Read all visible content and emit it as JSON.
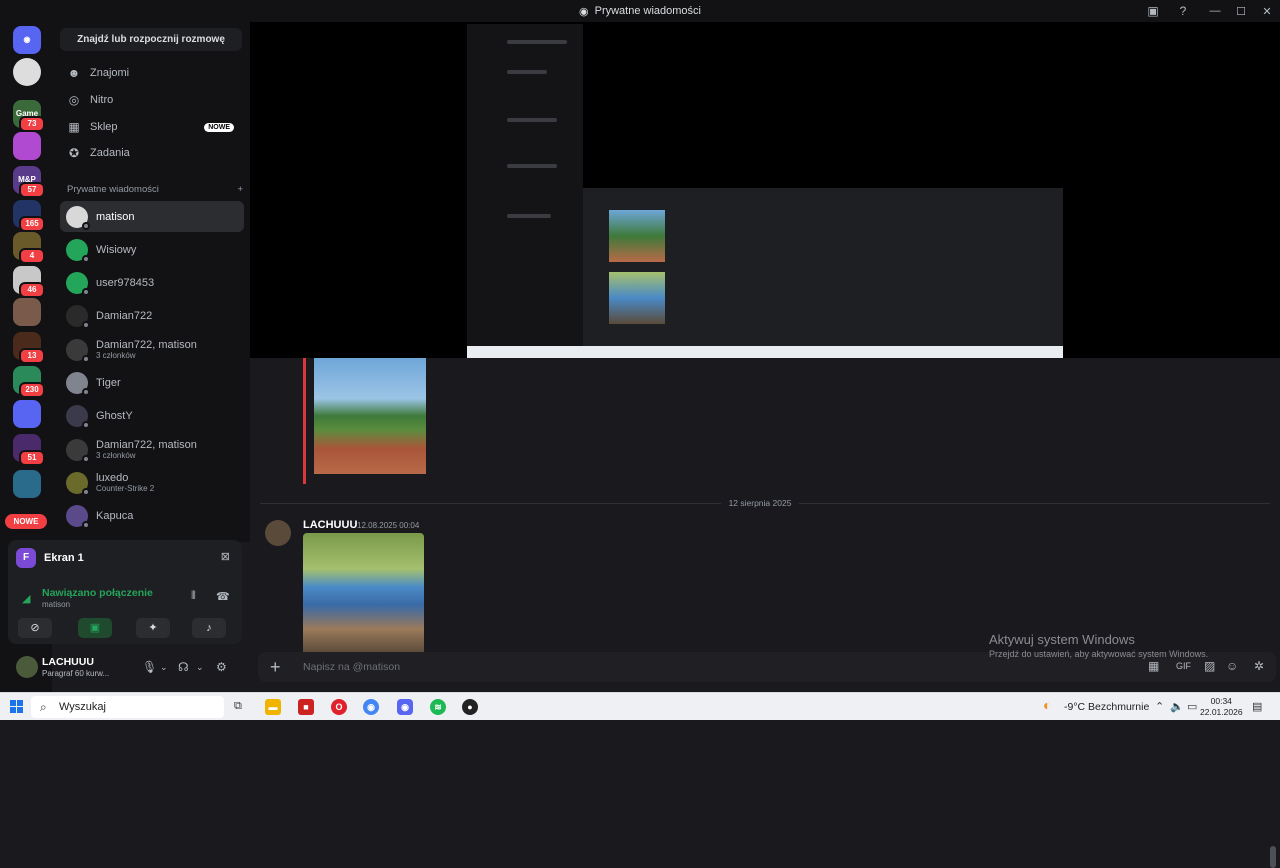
{
  "window": {
    "title": "Prywatne wiadomości"
  },
  "servers": [
    {
      "name": "Game",
      "badge": "73",
      "color": "#3a6a3a"
    },
    {
      "name": "",
      "badge": "",
      "color": "#b04ad0"
    },
    {
      "name": "M&P",
      "badge": "57",
      "color": "#5a3a8a"
    },
    {
      "name": "",
      "badge": "165",
      "color": "#223366"
    },
    {
      "name": "",
      "badge": "4",
      "color": "#6a5a2a"
    },
    {
      "name": "",
      "badge": "46",
      "color": "#c8c8c8"
    },
    {
      "name": "",
      "badge": "",
      "color": "#7a5a4a"
    },
    {
      "name": "",
      "badge": "13",
      "color": "#4a2a1a"
    },
    {
      "name": "",
      "badge": "230",
      "color": "#2a8a5a"
    },
    {
      "name": "",
      "badge": "",
      "color": "#5865f2"
    },
    {
      "name": "",
      "badge": "51",
      "color": "#4a2a6a"
    },
    {
      "name": "",
      "badge": "",
      "color": "#2a6a8a"
    }
  ],
  "new_label": "NOWE",
  "sidebar": {
    "search": "Znajdź lub rozpocznij rozmowę",
    "nav": [
      {
        "label": "Znajomi",
        "icon": "friends-icon"
      },
      {
        "label": "Nitro",
        "icon": "nitro-icon"
      },
      {
        "label": "Sklep",
        "icon": "shop-icon",
        "badge": "NOWE"
      },
      {
        "label": "Zadania",
        "icon": "quests-icon"
      }
    ],
    "dm_header": "Prywatne wiadomości",
    "dms": [
      {
        "name": "matison",
        "sub": "",
        "color": "#d8d8d8"
      },
      {
        "name": "Wisiowy",
        "sub": "",
        "color": "#23a55a"
      },
      {
        "name": "user978453",
        "sub": "",
        "color": "#23a55a"
      },
      {
        "name": "Damian722",
        "sub": "",
        "color": "#2a2a2a"
      },
      {
        "name": "Damian722, matison",
        "sub": "3 członków",
        "color": "#3a3a3a"
      },
      {
        "name": "Tiger",
        "sub": "",
        "color": "#80848e"
      },
      {
        "name": "GhostY",
        "sub": "",
        "color": "#3a3a4a"
      },
      {
        "name": "Damian722, matison",
        "sub": "3 członków",
        "color": "#3a3a3a"
      },
      {
        "name": "luxedo",
        "sub": "Counter-Strike 2",
        "color": "#6a6a2a"
      },
      {
        "name": "Kapuca",
        "sub": "",
        "color": "#5a4a8a"
      }
    ]
  },
  "voice": {
    "channel": "Ekran 1",
    "status": "Nawiązano połączenie",
    "server": "matison"
  },
  "user": {
    "name": "LACHUUU",
    "status": "Paragraf 60 kurw..."
  },
  "chat": {
    "date_divider": "12 sierpnia 2025",
    "author": "LACHUUU",
    "time": "12.08.2025 00:04",
    "placeholder": "Napisz na @matison"
  },
  "activation": {
    "title": "Aktywuj system Windows",
    "sub": "Przejdź do ustawień, aby aktywować system Windows."
  },
  "taskbar": {
    "search": "Wyszukaj",
    "weather": "-9°C  Bezchmurnie",
    "time": "00:34",
    "date": "22.01.2026"
  }
}
